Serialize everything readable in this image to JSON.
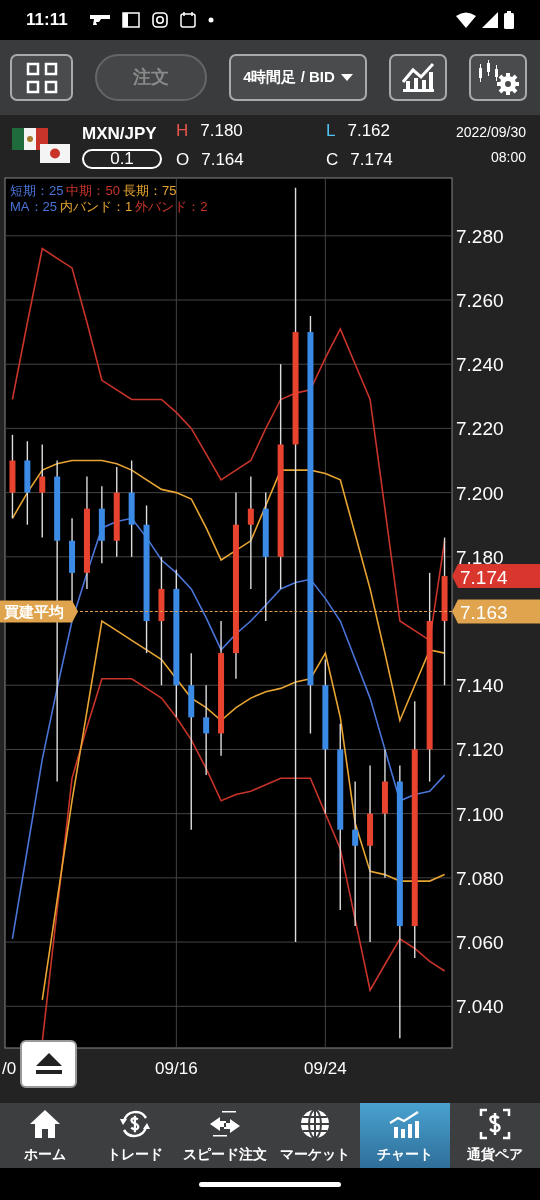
{
  "status_bar": {
    "time": "11:11"
  },
  "toolbar": {
    "order_button": {
      "label": "注文",
      "disabled": true
    },
    "timeframe": {
      "value": "4時間足 / BID"
    }
  },
  "quote": {
    "pair": "MXN/JPY",
    "lot": "0.1",
    "fields": [
      {
        "key": "H",
        "value": "7.180",
        "color": "#e9554c"
      },
      {
        "key": "L",
        "value": "7.162",
        "color": "#4fc3f7"
      },
      {
        "key": "O",
        "value": "7.164",
        "color": "#ffffff"
      },
      {
        "key": "C",
        "value": "7.174",
        "color": "#ffffff"
      }
    ],
    "date": "2022/09/30",
    "time": "08:00"
  },
  "legend": [
    [
      {
        "text": "短期：25",
        "color": "#4a74d8"
      },
      {
        "text": "中期：50",
        "color": "#c8342a"
      },
      {
        "text": "長期：75",
        "color": "#e8a532"
      }
    ],
    [
      {
        "text": "MA：25",
        "color": "#4a74d8"
      },
      {
        "text": "内バンド：1",
        "color": "#e8a532"
      },
      {
        "text": "外バンド：2",
        "color": "#c8342a"
      }
    ]
  ],
  "chart": {
    "current_price": "7.174",
    "average": {
      "label": "買建平均",
      "value": "7.163"
    },
    "chart_data": {
      "type": "candlestick",
      "ylim": [
        7.027,
        7.298
      ],
      "grid": true,
      "yticks": [
        {
          "value": 7.04,
          "label": "7.040"
        },
        {
          "value": 7.06,
          "label": "7.060"
        },
        {
          "value": 7.08,
          "label": "7.080"
        },
        {
          "value": 7.1,
          "label": "7.100"
        },
        {
          "value": 7.12,
          "label": "7.120"
        },
        {
          "value": 7.14,
          "label": "7.140"
        },
        {
          "value": 7.18,
          "label": "7.180"
        },
        {
          "value": 7.2,
          "label": "7.200"
        },
        {
          "value": 7.22,
          "label": "7.220"
        },
        {
          "value": 7.24,
          "label": "7.240"
        },
        {
          "value": 7.26,
          "label": "7.260"
        },
        {
          "value": 7.28,
          "label": "7.280"
        }
      ],
      "categories": [
        "/0",
        null,
        null,
        null,
        null,
        null,
        null,
        null,
        null,
        null,
        null,
        "09/16",
        null,
        null,
        null,
        null,
        null,
        null,
        null,
        null,
        null,
        "09/24",
        null,
        null,
        null,
        null,
        null,
        null,
        null,
        null
      ],
      "ohlc": [
        [
          7.2,
          7.218,
          7.192,
          7.21
        ],
        [
          7.21,
          7.216,
          7.19,
          7.2
        ],
        [
          7.2,
          7.215,
          7.186,
          7.205
        ],
        [
          7.205,
          7.21,
          7.11,
          7.185
        ],
        [
          7.185,
          7.192,
          7.16,
          7.175
        ],
        [
          7.175,
          7.205,
          7.17,
          7.195
        ],
        [
          7.195,
          7.202,
          7.178,
          7.185
        ],
        [
          7.185,
          7.208,
          7.18,
          7.2
        ],
        [
          7.2,
          7.21,
          7.18,
          7.19
        ],
        [
          7.19,
          7.196,
          7.15,
          7.16
        ],
        [
          7.16,
          7.18,
          7.14,
          7.17
        ],
        [
          7.17,
          7.176,
          7.13,
          7.14
        ],
        [
          7.14,
          7.15,
          7.095,
          7.13
        ],
        [
          7.13,
          7.14,
          7.112,
          7.125
        ],
        [
          7.125,
          7.16,
          7.118,
          7.15
        ],
        [
          7.15,
          7.2,
          7.142,
          7.19
        ],
        [
          7.19,
          7.205,
          7.17,
          7.195
        ],
        [
          7.195,
          7.2,
          7.16,
          7.18
        ],
        [
          7.18,
          7.24,
          7.17,
          7.215
        ],
        [
          7.215,
          7.295,
          7.06,
          7.25
        ],
        [
          7.25,
          7.255,
          7.125,
          7.14
        ],
        [
          7.14,
          7.148,
          7.1,
          7.12
        ],
        [
          7.12,
          7.128,
          7.07,
          7.095
        ],
        [
          7.095,
          7.11,
          7.065,
          7.09
        ],
        [
          7.09,
          7.115,
          7.06,
          7.1
        ],
        [
          7.1,
          7.12,
          7.08,
          7.11
        ],
        [
          7.11,
          7.115,
          7.03,
          7.065
        ],
        [
          7.065,
          7.135,
          7.055,
          7.12
        ],
        [
          7.12,
          7.175,
          7.11,
          7.16
        ],
        [
          7.16,
          7.186,
          7.14,
          7.174
        ]
      ],
      "series": [
        {
          "type": "line",
          "color": "#4a74d8",
          "values": [
            7.061,
            7.089,
            7.117,
            7.139,
            7.16,
            7.175,
            7.189,
            7.191,
            7.192,
            7.186,
            7.179,
            7.175,
            7.17,
            7.161,
            7.151,
            7.156,
            7.16,
            7.165,
            7.17,
            7.172,
            7.173,
            7.167,
            7.16,
            7.148,
            7.136,
            7.12,
            7.104,
            7.106,
            7.107,
            7.112
          ]
        },
        {
          "type": "line",
          "color": "#c8342a",
          "values": [
            7.229,
            7.253,
            7.276,
            7.273,
            7.27,
            7.253,
            7.235,
            7.232,
            7.229,
            7.229,
            7.229,
            7.225,
            7.22,
            7.212,
            7.204,
            7.207,
            7.21,
            7.22,
            7.229,
            7.231,
            7.232,
            7.242,
            7.251,
            7.24,
            7.229,
            7.195,
            7.16,
            7.157,
            7.154,
            7.185
          ]
        },
        {
          "type": "line",
          "color": "#c8342a",
          "values": [
            null,
            null,
            7.029,
            7.07,
            7.111,
            7.127,
            7.142,
            7.142,
            7.142,
            7.139,
            7.136,
            7.13,
            7.123,
            7.114,
            7.104,
            7.106,
            7.107,
            7.109,
            7.111,
            7.111,
            7.111,
            7.1,
            7.089,
            7.067,
            7.045,
            7.053,
            7.061,
            7.058,
            7.054,
            7.051
          ]
        },
        {
          "type": "line",
          "color": "#e8a532",
          "values": [
            7.192,
            7.2,
            7.207,
            7.209,
            7.21,
            7.21,
            7.21,
            7.209,
            7.207,
            7.204,
            7.201,
            7.2,
            7.198,
            7.189,
            7.179,
            7.182,
            7.185,
            7.196,
            7.207,
            7.207,
            7.207,
            7.206,
            7.204,
            7.187,
            7.17,
            7.15,
            7.129,
            7.14,
            7.151,
            7.15
          ]
        },
        {
          "type": "line",
          "color": "#e8a532",
          "values": [
            null,
            null,
            7.042,
            7.073,
            7.104,
            7.132,
            7.16,
            7.157,
            7.154,
            7.151,
            7.148,
            7.142,
            7.136,
            7.133,
            7.129,
            7.133,
            7.136,
            7.138,
            7.139,
            7.141,
            7.142,
            7.15,
            7.13,
            7.097,
            7.082,
            7.081,
            7.079,
            7.079,
            7.079,
            7.081
          ]
        }
      ]
    }
  },
  "nav": [
    {
      "label": "ホーム",
      "selected": false
    },
    {
      "label": "トレード",
      "selected": false
    },
    {
      "label": "スピード注文",
      "selected": false
    },
    {
      "label": "マーケット",
      "selected": false
    },
    {
      "label": "チャート",
      "selected": true
    },
    {
      "label": "通貨ペア",
      "selected": false
    }
  ]
}
